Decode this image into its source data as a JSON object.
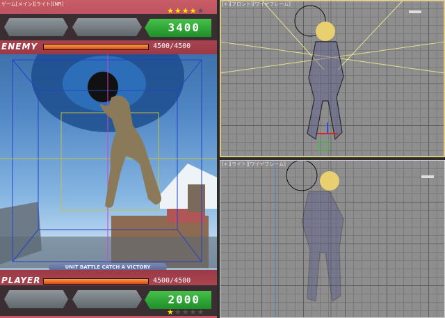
{
  "game_viewport": {
    "title": "ゲーム[メイン][ライト][NR]",
    "enemy": {
      "label": "ENEMY",
      "hp_text": "4500/4500",
      "hp_fraction": 1.0
    },
    "player": {
      "label": "PLAYER",
      "hp_text": "4500/4500",
      "hp_fraction": 1.0
    },
    "top_score": "3400",
    "top_stars": {
      "filled": 4,
      "total": 5
    },
    "bottom_score": "2000",
    "bottom_stars": {
      "filled": 1,
      "total": 5
    },
    "banner": "UNIT BATTLE CATCH A VICTORY"
  },
  "front_viewport": {
    "label": "[+][フロント][ワイヤフレーム]"
  },
  "right_viewport": {
    "label": "[+][ライト][ワイヤフレーム]"
  },
  "colors": {
    "active_border": "#f2c23c",
    "hud_red": "#c85c67",
    "score_green": "#2fa83a",
    "star_yellow": "#ffe600",
    "hp_orange": "#e8621c"
  }
}
